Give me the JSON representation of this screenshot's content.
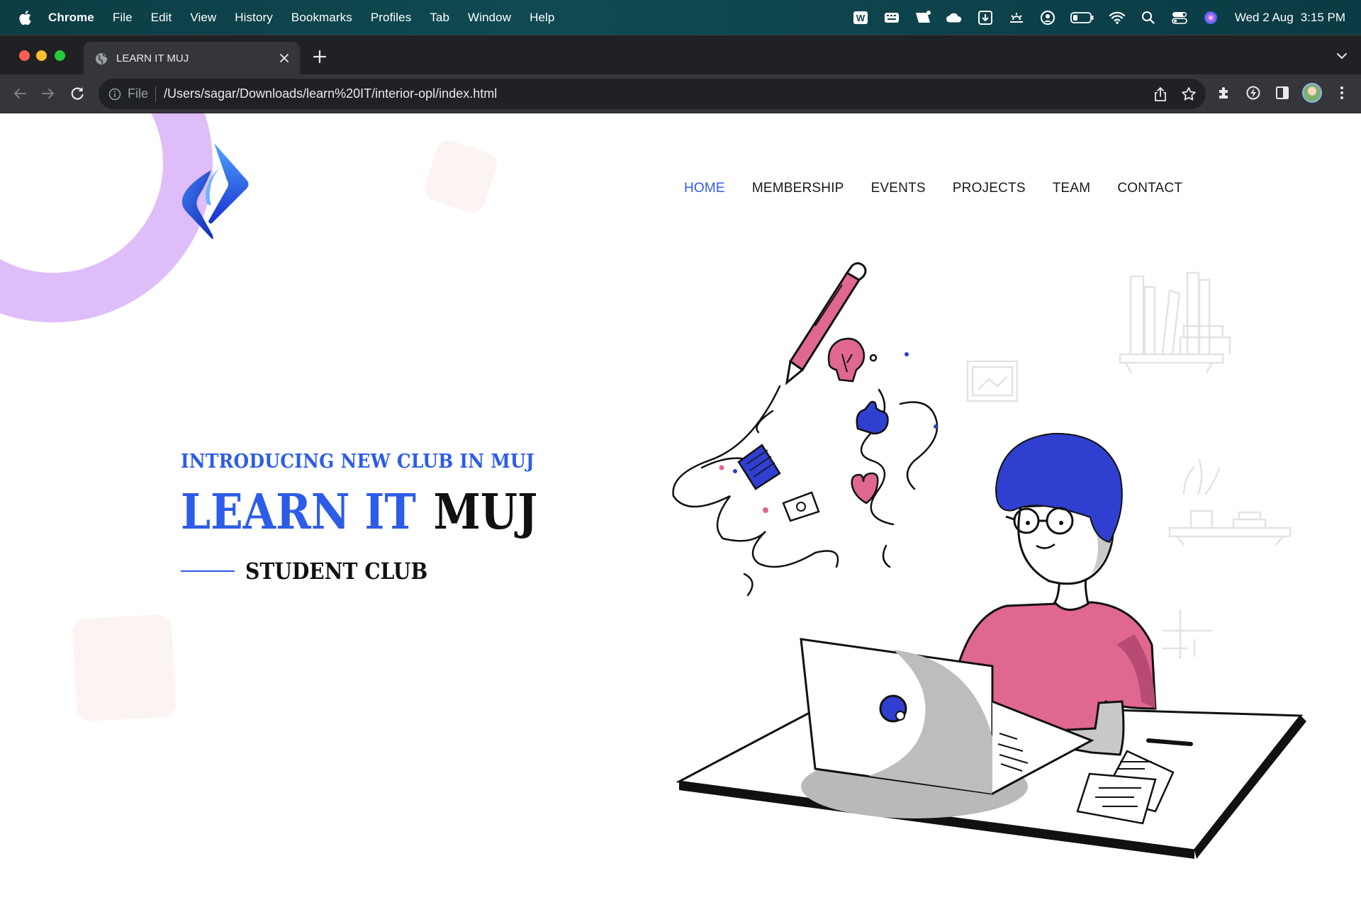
{
  "menubar": {
    "app_name": "Chrome",
    "items": [
      "File",
      "Edit",
      "View",
      "History",
      "Bookmarks",
      "Profiles",
      "Tab",
      "Window",
      "Help"
    ],
    "date": "Wed 2 Aug",
    "time": "3:15 PM",
    "status_icons": [
      "word-icon",
      "keyboard-icon",
      "notification-icon",
      "cloud-icon",
      "download-icon",
      "brightness-icon",
      "user-circle-icon",
      "battery-icon",
      "wifi-icon",
      "spotlight-search-icon",
      "control-center-icon",
      "siri-icon"
    ]
  },
  "browser": {
    "tab_title": "LEARN IT MUJ",
    "url_scheme": "File",
    "url": "/Users/sagar/Downloads/learn%20IT/interior-opl/index.html"
  },
  "site": {
    "nav": [
      "HOME",
      "MEMBERSHIP",
      "EVENTS",
      "PROJECTS",
      "TEAM",
      "CONTACT"
    ],
    "active_nav": "HOME",
    "intro": "INTRODUCING NEW CLUB IN MUJ",
    "title_part1": "LEARN IT",
    "title_part2": "MUJ",
    "subtitle": "STUDENT CLUB"
  },
  "colors": {
    "accent_blue": "#2d5ce8",
    "deco_purple": "#dfbdf9",
    "shirt_pink": "#e0678f",
    "hair_blue": "#2f3fd0"
  }
}
